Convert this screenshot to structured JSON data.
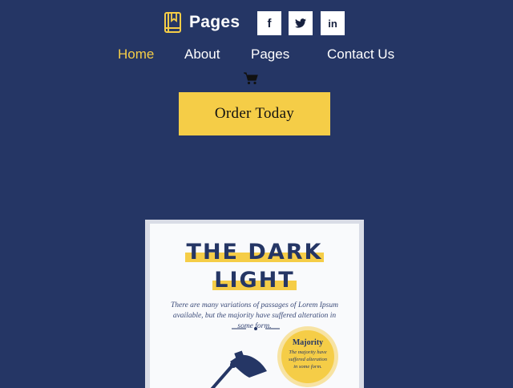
{
  "brand": {
    "name": "Pages",
    "icon": "book-icon"
  },
  "social": [
    {
      "name": "facebook-icon",
      "glyph": "f"
    },
    {
      "name": "twitter-icon",
      "glyph": "t"
    },
    {
      "name": "linkedin-icon",
      "glyph": "in"
    }
  ],
  "nav": {
    "home": "Home",
    "about": "About",
    "pages": "Pages",
    "contact": "Contact Us"
  },
  "cart": {
    "icon": "cart-icon"
  },
  "cta": {
    "label": "Order Today"
  },
  "book": {
    "title_line1": "THE DARK",
    "title_line2": "LIGHT",
    "subtitle": "There are many variations of passages of Lorem Ipsum available, but the majority have suffered alteration in some form.",
    "badge_title": "Majority",
    "badge_text": "The majority have suffered alteration in some form."
  },
  "colors": {
    "background": "#253665",
    "accent": "#f5cd47",
    "text": "#ffffff"
  }
}
